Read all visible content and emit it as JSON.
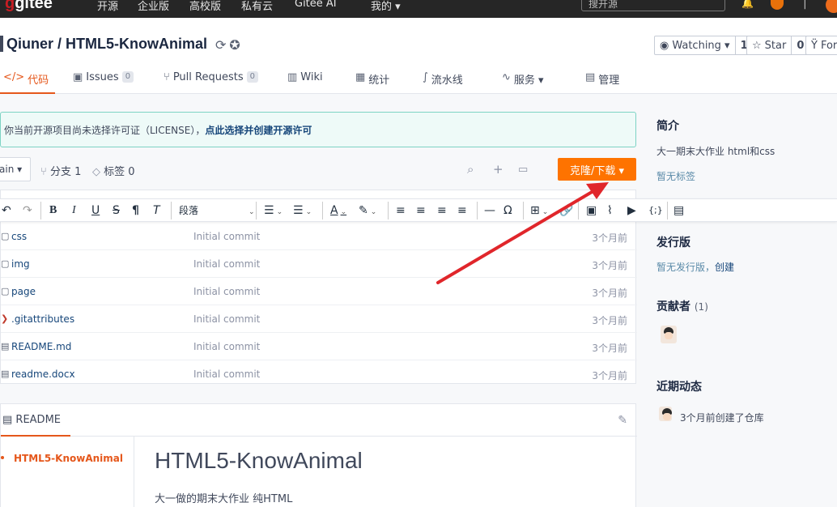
{
  "topnav": {
    "logo_main": "gitee",
    "items": [
      "开源",
      "企业版",
      "高校版",
      "私有云",
      "Gitee AI",
      "我的 ▾"
    ],
    "search_placeholder": "搜开源"
  },
  "repo": {
    "owner": "Qiuner",
    "name": "HTML5-KnowAnimal",
    "title": "Qiuner / HTML5-KnowAnimal",
    "watch_label": "Watching ▾",
    "watch_count": "1",
    "star_label": "Star",
    "star_count": "0",
    "fork_label": "For"
  },
  "tabs": [
    {
      "label": "代码",
      "icon": "code-icon"
    },
    {
      "label": "Issues",
      "badge": "0",
      "icon": "issues-icon"
    },
    {
      "label": "Pull Requests",
      "badge": "0",
      "icon": "pull-request-icon"
    },
    {
      "label": "Wiki",
      "icon": "wiki-icon"
    },
    {
      "label": "统计",
      "icon": "stats-icon"
    },
    {
      "label": "流水线",
      "icon": "pipeline-icon"
    },
    {
      "label": "服务 ▾",
      "icon": "service-icon"
    },
    {
      "label": "管理",
      "icon": "manage-icon"
    }
  ],
  "notice": {
    "text": "你当前开源项目尚未选择许可证（LICENSE），",
    "link": "点此选择并创建开源许可"
  },
  "branch_bar": {
    "branch": "ain ▾",
    "branches": "分支 1",
    "tags": "标签 0",
    "clone_label": "克隆/下载 ▾"
  },
  "editor_toolbar": {
    "paragraph_label": "段落"
  },
  "files": [
    {
      "name": "css",
      "message": "Initial commit",
      "time": "3个月前",
      "icon": "folder-icon"
    },
    {
      "name": "img",
      "message": "Initial commit",
      "time": "3个月前",
      "icon": "folder-icon"
    },
    {
      "name": "page",
      "message": "Initial commit",
      "time": "3个月前",
      "icon": "folder-icon"
    },
    {
      "name": ".gitattributes",
      "message": "Initial commit",
      "time": "3个月前",
      "icon": "git-icon"
    },
    {
      "name": "README.md",
      "message": "Initial commit",
      "time": "3个月前",
      "icon": "file-icon"
    },
    {
      "name": "readme.docx",
      "message": "Initial commit",
      "time": "3个月前",
      "icon": "file-icon"
    }
  ],
  "readme": {
    "tab_label": "README",
    "toc_item": "HTML5-KnowAnimal",
    "heading": "HTML5-KnowAnimal",
    "paragraph": "大一做的期末大作业 纯HTML"
  },
  "sidebar": {
    "intro_title": "简介",
    "intro_text": "大一期末大作业 html和css",
    "no_tags": "暂无标签",
    "release_title": "发行版",
    "no_release": "暂无发行版，",
    "create_link": "创建",
    "contributors_title": "贡献者",
    "contributors_count": "(1)",
    "activity_title": "近期动态",
    "activity_text": "3个月前创建了仓库"
  }
}
